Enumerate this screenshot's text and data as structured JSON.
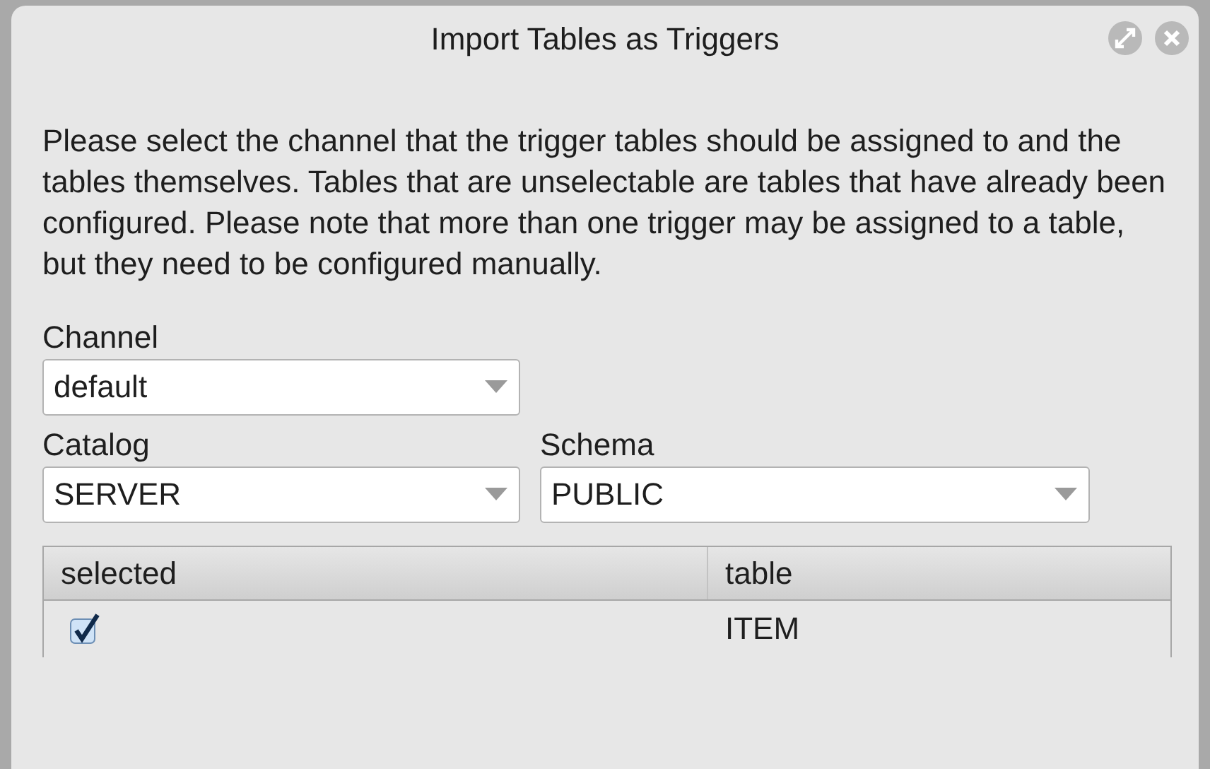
{
  "window": {
    "title": "Import Tables as Triggers"
  },
  "message": "Please select the channel that the trigger tables should be assigned to and the tables themselves. Tables that are unselectable are tables that have already been configured. Please note that more than one trigger may be assigned to a table, but they need to be configured manually.",
  "channel": {
    "label": "Channel",
    "value": "default"
  },
  "catalog": {
    "label": "Catalog",
    "value": "SERVER"
  },
  "schema": {
    "label": "Schema",
    "value": "PUBLIC"
  },
  "table": {
    "columns": [
      "selected",
      "table"
    ],
    "rows": [
      {
        "checked": true,
        "name": "ITEM"
      }
    ]
  }
}
